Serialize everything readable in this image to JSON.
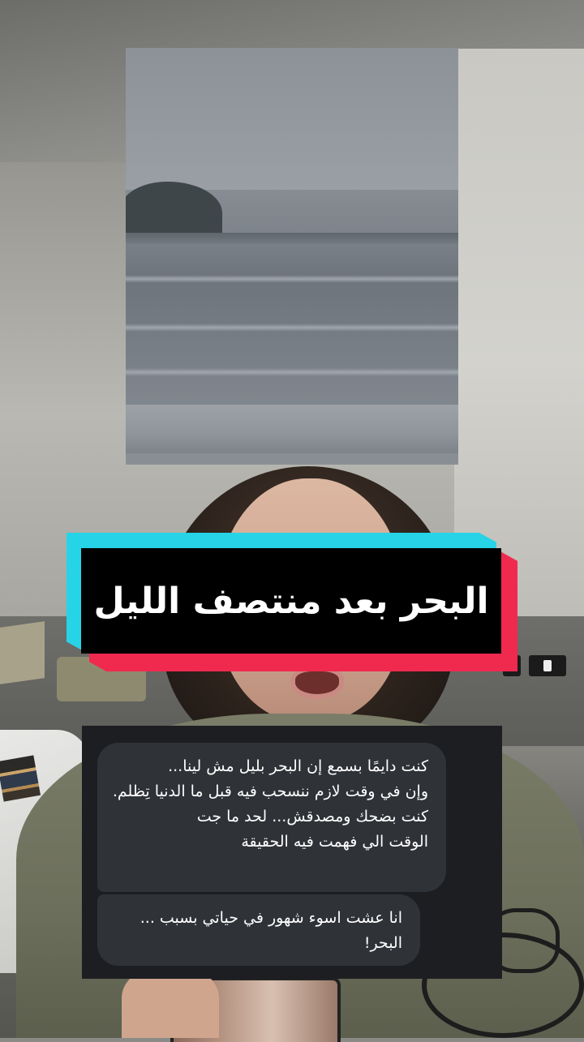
{
  "video": {
    "title": "البحر بعد منتصف الليل"
  },
  "chat": {
    "message_1": "كنت دايمًا بسمع إن البحر بليل مش لينا...\nوإن في وقت لازم ننسحب فيه قبل ما الدنيا تِظلم.\nكنت بضحك ومصدقش... لحد ما جت\nالوقت الي فهمت فيه الحقيقة",
    "message_2": "انا عشت اسوء شهور في حياتي بسبب ...\nالبحر!"
  },
  "colors": {
    "banner_cyan": "#27d3e6",
    "banner_red": "#f0294f",
    "banner_black": "#000000",
    "bubble": "#2f3237",
    "chat_panel": "#1c1e22"
  }
}
